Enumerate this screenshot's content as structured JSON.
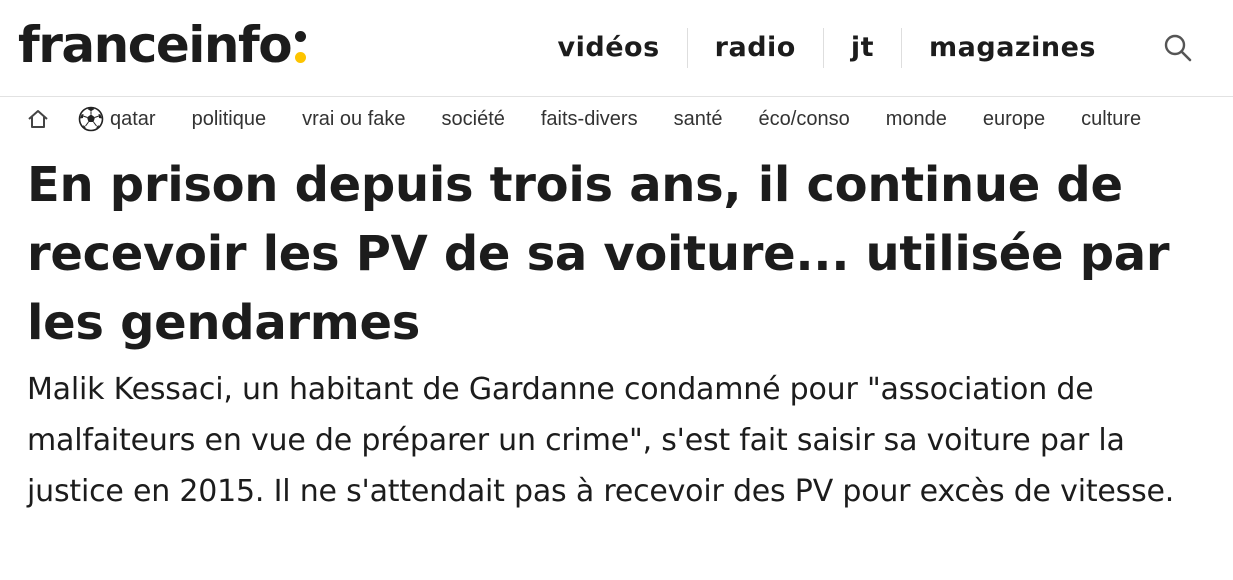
{
  "header": {
    "logo_text": "franceinfo",
    "nav": [
      "vidéos",
      "radio",
      "jt",
      "magazines"
    ],
    "search_icon": "search-icon"
  },
  "rubrics": {
    "home_icon": "home-icon",
    "items": [
      {
        "label": "qatar",
        "icon": "football-icon"
      },
      {
        "label": "politique"
      },
      {
        "label": "vrai ou fake"
      },
      {
        "label": "société"
      },
      {
        "label": "faits-divers"
      },
      {
        "label": "santé"
      },
      {
        "label": "éco/conso"
      },
      {
        "label": "monde"
      },
      {
        "label": "europe"
      },
      {
        "label": "culture"
      }
    ]
  },
  "article": {
    "title": "En prison depuis trois ans, il continue de recevoir les PV de sa voiture... utilisée par les gendarmes",
    "lead": "Malik Kessaci, un habitant de Gardanne condamné pour \"association de malfaiteurs en vue de préparer un crime\", s'est fait saisir sa voiture par la justice en 2015. Il ne s'attendait pas à recevoir des PV pour excès de vitesse."
  },
  "colors": {
    "text": "#1c1c1c",
    "logo_accent": "#fdc400"
  }
}
